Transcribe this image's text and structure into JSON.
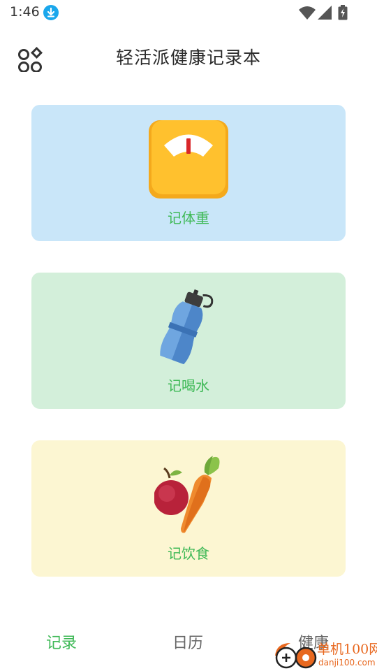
{
  "status_bar": {
    "time": "1:46",
    "icons": [
      "download-icon",
      "wifi-icon",
      "signal-icon",
      "battery-charging-icon"
    ]
  },
  "header": {
    "title": "轻活派健康记录本",
    "menu_icon": "apps-grid-icon"
  },
  "cards": [
    {
      "label": "记体重",
      "icon": "bathroom-scale-icon",
      "background": "#c9e6f9"
    },
    {
      "label": "记喝水",
      "icon": "water-bottle-icon",
      "background": "#d3efda"
    },
    {
      "label": "记饮食",
      "icon": "apple-carrot-icon",
      "background": "#fcf6d2"
    }
  ],
  "bottom_nav": {
    "items": [
      {
        "label": "记录",
        "active": true
      },
      {
        "label": "日历",
        "active": false
      },
      {
        "label": "健康",
        "active": false
      }
    ],
    "active_color": "#3fb957",
    "inactive_color": "#666666"
  },
  "watermark": {
    "name": "单机100网",
    "url": "danji100.com"
  },
  "colors": {
    "accent_green": "#3fb957",
    "watermark_orange": "#e8681f"
  }
}
